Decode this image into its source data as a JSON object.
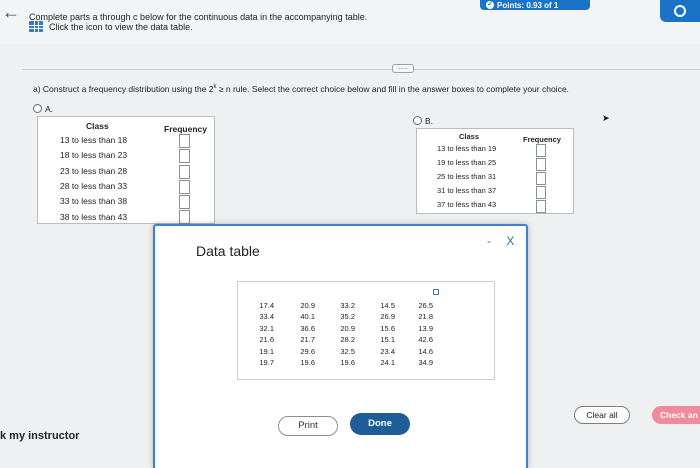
{
  "header": {
    "points_label": "Points: 0.93 of 1",
    "prompt_line1": "Complete parts a through c below for the continuous data in the accompanying table.",
    "prompt_line2": "Click the icon to view the data table.",
    "more_handle": "....."
  },
  "question": {
    "text_before": "a) Construct a frequency distribution using the 2",
    "superscript": "k",
    "text_after": " ≥ n rule. Select the correct choice below and fill in the answer boxes to complete your choice."
  },
  "options": [
    {
      "label": "A.",
      "class_header": "Class",
      "freq_header": "Frequency",
      "rows": [
        "13 to less than 18",
        "18 to less than 23",
        "23 to less than 28",
        "28 to less than 33",
        "33 to less than 38",
        "38 to less than 43"
      ]
    },
    {
      "label": "B.",
      "class_header": "Class",
      "freq_header": "Frequency",
      "rows": [
        "13 to less than 19",
        "19 to less than 25",
        "25 to less than 31",
        "31 to less than 37",
        "37 to less than 43"
      ]
    }
  ],
  "modal": {
    "title": "Data table",
    "controls": "- X",
    "columns": [
      [
        "17.4",
        "33.4",
        "32.1",
        "21.6",
        "19.1",
        "19.7"
      ],
      [
        "20.9",
        "40.1",
        "36.6",
        "21.7",
        "29.6",
        "19.6"
      ],
      [
        "33.2",
        "35.2",
        "20.9",
        "28.2",
        "32.5",
        "19.6"
      ],
      [
        "14.5",
        "26.9",
        "15.6",
        "15.1",
        "23.4",
        "24.1"
      ],
      [
        "26.5",
        "21.8",
        "13.9",
        "42.6",
        "14.6",
        "34.9"
      ]
    ],
    "print_label": "Print",
    "done_label": "Done"
  },
  "footer": {
    "instructor_label": "k my instructor",
    "clear_label": "Clear all",
    "check_label": "Check an"
  },
  "colors": {
    "accent": "#1a73c7",
    "done_button": "#1f5d99",
    "check_button": "#f08a9c"
  }
}
